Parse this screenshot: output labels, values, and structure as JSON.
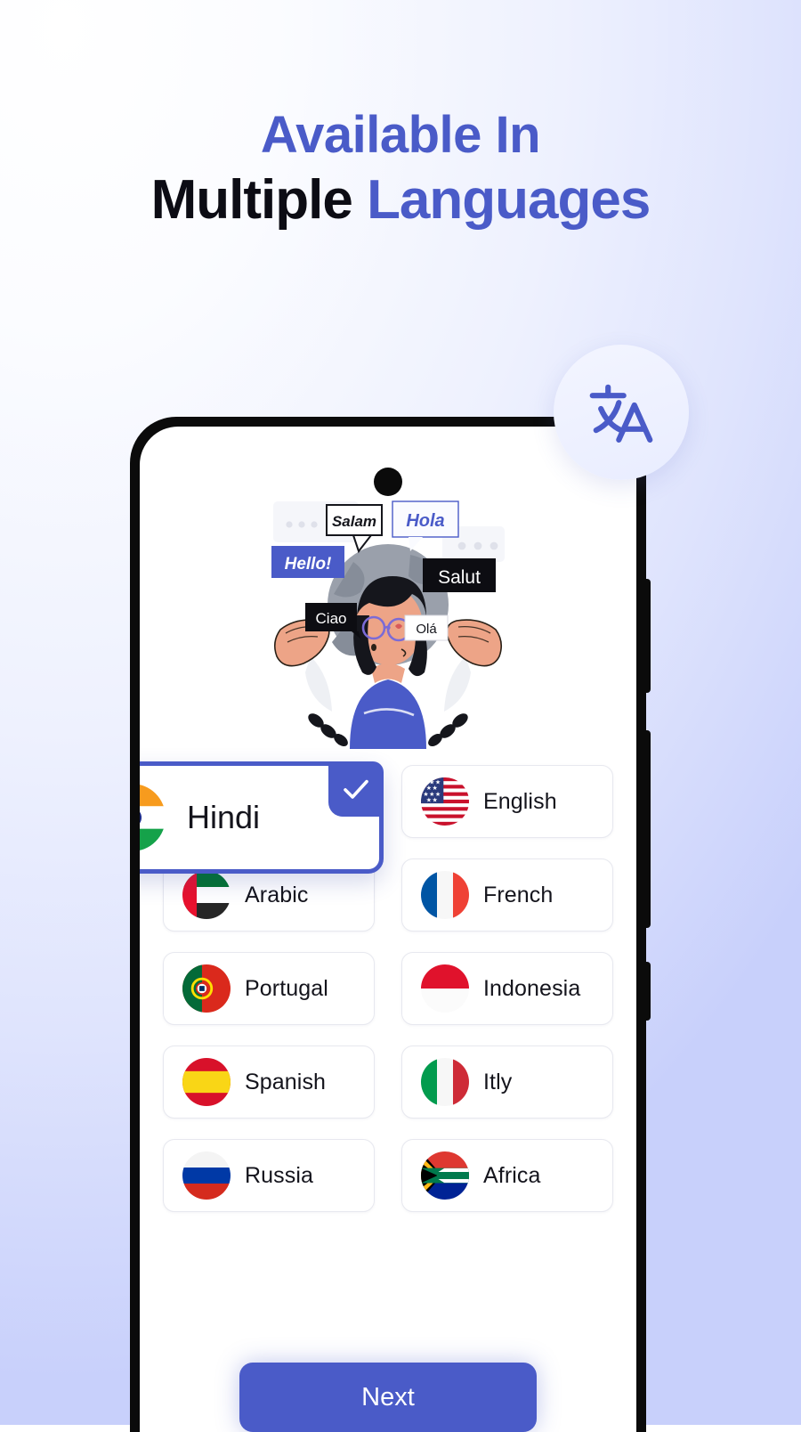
{
  "theme": {
    "accent": "#4a5bc8",
    "headline_dark": "#0c0c14",
    "bg_from": "#ffffff",
    "bg_to": "#c8d0fb",
    "card_border": "#e7e8ef",
    "phone_frame": "#0b0b0b"
  },
  "headline": {
    "line1": "Available In",
    "line2_dark": "Multiple",
    "line2_blue": "Languages"
  },
  "translate_badge": {
    "icon": "translate-icon",
    "glyph_cjk": "文",
    "glyph_latin": "A"
  },
  "illustration": {
    "name": "multilingual-greetings-illustration",
    "bubbles": [
      {
        "text": "Salam",
        "style": "white"
      },
      {
        "text": "Hola",
        "style": "white-blue-text"
      },
      {
        "text": "Hello!",
        "style": "blue"
      },
      {
        "text": "Salut",
        "style": "black"
      },
      {
        "text": "Ciao",
        "style": "black"
      },
      {
        "text": "Olá",
        "style": "white"
      }
    ]
  },
  "selected_language": {
    "label": "Hindi",
    "flag": "flag-india",
    "selected": true,
    "check_icon": "check-icon"
  },
  "languages": [
    {
      "label": "English",
      "flag": "flag-usa"
    },
    {
      "label": "Arabic",
      "flag": "flag-uae"
    },
    {
      "label": "French",
      "flag": "flag-france"
    },
    {
      "label": "Portugal",
      "flag": "flag-portugal"
    },
    {
      "label": "Indonesia",
      "flag": "flag-indonesia"
    },
    {
      "label": "Spanish",
      "flag": "flag-spain"
    },
    {
      "label": "Itly",
      "flag": "flag-italy"
    },
    {
      "label": "Russia",
      "flag": "flag-russia"
    },
    {
      "label": "Africa",
      "flag": "flag-south-africa"
    }
  ],
  "next_button": {
    "label": "Next"
  }
}
